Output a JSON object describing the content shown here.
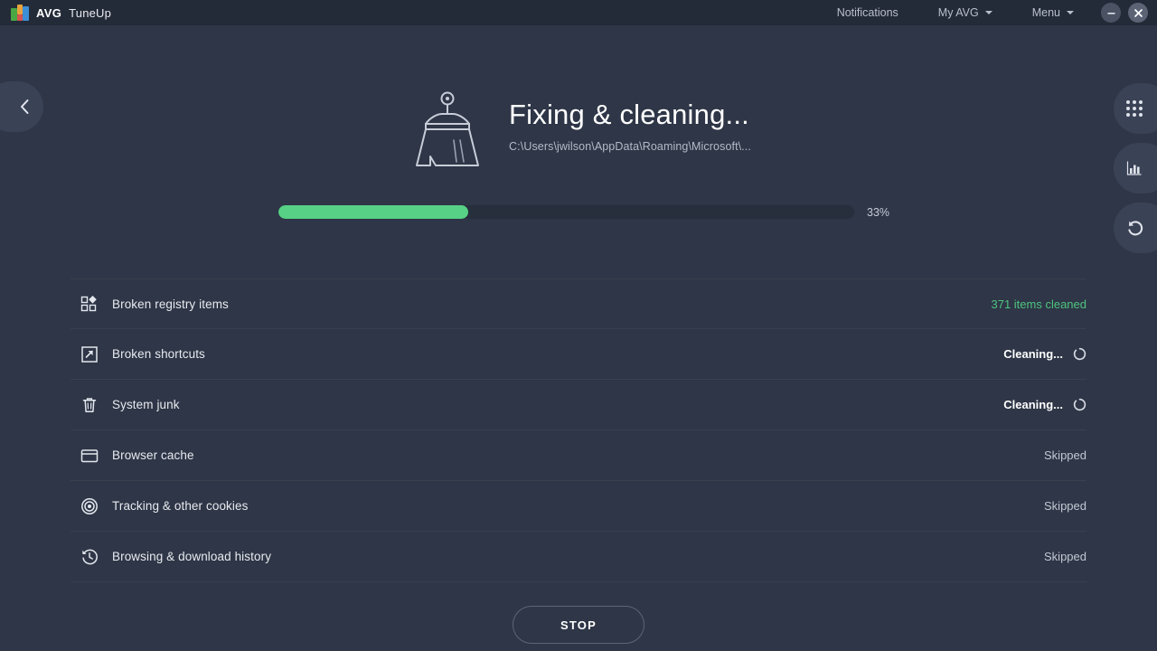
{
  "titlebar": {
    "brand_avg": "AVG",
    "brand_product": "TuneUp",
    "nav": [
      {
        "label": "Notifications",
        "has_caret": false,
        "name": "notifications"
      },
      {
        "label": "My AVG",
        "has_caret": true,
        "name": "my-avg"
      },
      {
        "label": "Menu",
        "has_caret": true,
        "name": "menu"
      }
    ],
    "minimize_label": "Minimize",
    "close_label": "Close"
  },
  "nav_tabs": {
    "back_label": "Back",
    "side": [
      {
        "name": "all-tools",
        "icon": "grid-icon"
      },
      {
        "name": "statistics",
        "icon": "bar-chart-icon"
      },
      {
        "name": "rescue-center",
        "icon": "undo-icon"
      }
    ]
  },
  "hero": {
    "icon": "broom-icon",
    "title": "Fixing & cleaning...",
    "path": "C:\\Users\\jwilson\\AppData\\Roaming\\Microsoft\\..."
  },
  "progress": {
    "percent": 33,
    "percent_label": "33%",
    "fill_color": "#57d185",
    "track_color": "#272e3c"
  },
  "items": [
    {
      "name": "broken-registry-items",
      "icon": "registry-icon",
      "label": "Broken registry items",
      "status": "371 items cleaned",
      "status_kind": "done",
      "spinner": false
    },
    {
      "name": "broken-shortcuts",
      "icon": "shortcut-icon",
      "label": "Broken shortcuts",
      "status": "Cleaning...",
      "status_kind": "active",
      "spinner": true
    },
    {
      "name": "system-junk",
      "icon": "trash-icon",
      "label": "System junk",
      "status": "Cleaning...",
      "status_kind": "active",
      "spinner": true
    },
    {
      "name": "browser-cache",
      "icon": "browser-window-icon",
      "label": "Browser cache",
      "status": "Skipped",
      "status_kind": "skipped",
      "spinner": false
    },
    {
      "name": "tracking-cookies",
      "icon": "cookie-target-icon",
      "label": "Tracking & other cookies",
      "status": "Skipped",
      "status_kind": "skipped",
      "spinner": false
    },
    {
      "name": "browsing-download-history",
      "icon": "clock-history-icon",
      "label": "Browsing & download history",
      "status": "Skipped",
      "status_kind": "skipped",
      "spinner": false
    }
  ],
  "footer": {
    "stop_label": "STOP"
  },
  "colors": {
    "background": "#2e3647",
    "titlebar": "#242b38",
    "accent_green": "#57d185",
    "status_done": "#4fc47e",
    "tab": "#3a4256",
    "divider": "#39414f"
  }
}
